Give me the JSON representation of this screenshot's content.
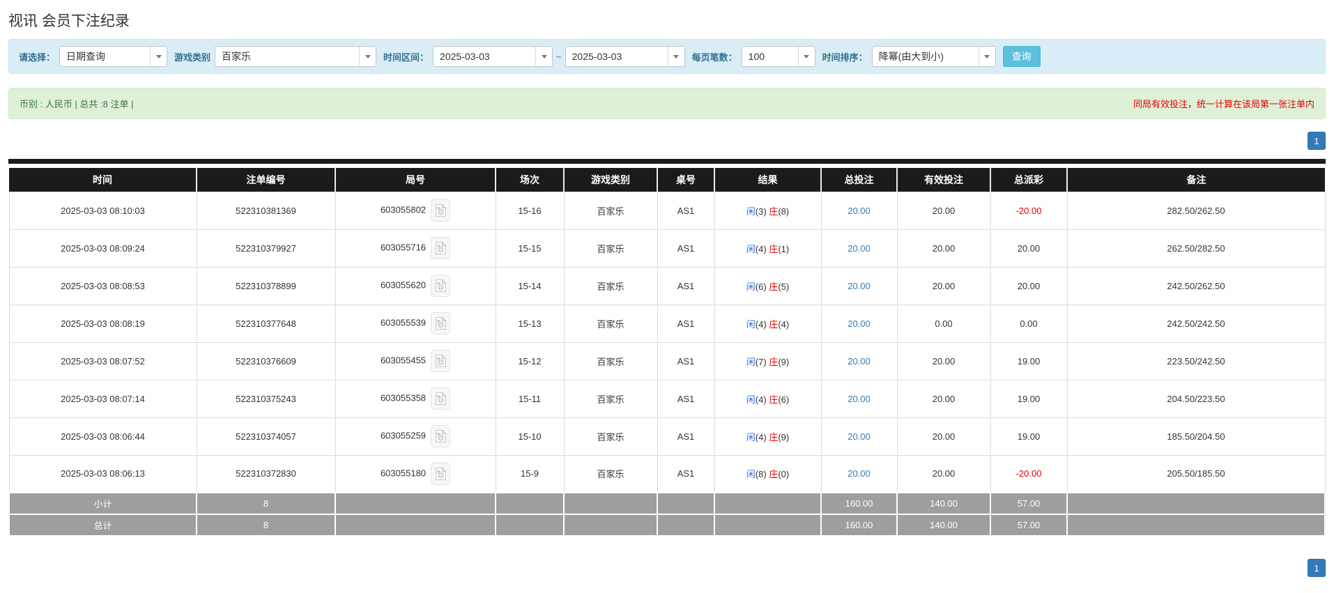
{
  "page": {
    "title": "视讯 会员下注纪录"
  },
  "colors": {
    "accent_blue": "#5bc0de",
    "link_blue": "#337ab7",
    "player_blue": "#2f6bd8",
    "banker_red": "#e60000",
    "negative_red": "#e60000",
    "note_red": "#e00000",
    "filter_bg": "#d9edf7",
    "summary_bg": "#dff0d8",
    "summary_text": "#3c763d",
    "header_bg": "#1b1b1b",
    "footer_bg": "#9e9e9e"
  },
  "icons": {
    "dropdown_arrow": "chevron-down-icon",
    "round_video": "video-record-icon"
  },
  "filter": {
    "select_label": "请选择：",
    "select_value": "日期查询",
    "game_label": "游戏类别",
    "game_value": "百家乐",
    "range_label": "时间区间：",
    "date_from": "2025-03-03",
    "tilde": "~",
    "date_to": "2025-03-03",
    "per_page_label": "每页笔数：",
    "per_page_value": "100",
    "sort_label": "时间排序：",
    "sort_value": "降幂(由大到小)",
    "query_button": "查询"
  },
  "summary": {
    "left": "币别 : 人民币 | 总共 :8 注单 |",
    "right": "同局有效投注，统一计算在该局第一张注单内"
  },
  "pagination": {
    "page": "1"
  },
  "table": {
    "headers": [
      "时间",
      "注单编号",
      "局号",
      "场次",
      "游戏类别",
      "桌号",
      "结果",
      "总投注",
      "有效投注",
      "总派彩",
      "备注"
    ],
    "rows": [
      {
        "time": "2025-03-03 08:10:03",
        "bet_no": "522310381369",
        "round_no": "603055802",
        "session": "15-16",
        "game": "百家乐",
        "table_no": "AS1",
        "result": {
          "player": "闲",
          "player_n": "(3)",
          "banker": "庄",
          "banker_n": "(8)"
        },
        "total_bet": "20.00",
        "valid_bet": "20.00",
        "payout": "-20.00",
        "payout_red": true,
        "remark": "282.50/262.50"
      },
      {
        "time": "2025-03-03 08:09:24",
        "bet_no": "522310379927",
        "round_no": "603055716",
        "session": "15-15",
        "game": "百家乐",
        "table_no": "AS1",
        "result": {
          "player": "闲",
          "player_n": "(4)",
          "banker": "庄",
          "banker_n": "(1)"
        },
        "total_bet": "20.00",
        "valid_bet": "20.00",
        "payout": "20.00",
        "payout_red": false,
        "remark": "262.50/282.50"
      },
      {
        "time": "2025-03-03 08:08:53",
        "bet_no": "522310378899",
        "round_no": "603055620",
        "session": "15-14",
        "game": "百家乐",
        "table_no": "AS1",
        "result": {
          "player": "闲",
          "player_n": "(6)",
          "banker": "庄",
          "banker_n": "(5)"
        },
        "total_bet": "20.00",
        "valid_bet": "20.00",
        "payout": "20.00",
        "payout_red": false,
        "remark": "242.50/262.50"
      },
      {
        "time": "2025-03-03 08:08:19",
        "bet_no": "522310377648",
        "round_no": "603055539",
        "session": "15-13",
        "game": "百家乐",
        "table_no": "AS1",
        "result": {
          "player": "闲",
          "player_n": "(4)",
          "banker": "庄",
          "banker_n": "(4)"
        },
        "total_bet": "20.00",
        "valid_bet": "0.00",
        "payout": "0.00",
        "payout_red": false,
        "remark": "242.50/242.50"
      },
      {
        "time": "2025-03-03 08:07:52",
        "bet_no": "522310376609",
        "round_no": "603055455",
        "session": "15-12",
        "game": "百家乐",
        "table_no": "AS1",
        "result": {
          "player": "闲",
          "player_n": "(7)",
          "banker": "庄",
          "banker_n": "(9)"
        },
        "total_bet": "20.00",
        "valid_bet": "20.00",
        "payout": "19.00",
        "payout_red": false,
        "remark": "223.50/242.50"
      },
      {
        "time": "2025-03-03 08:07:14",
        "bet_no": "522310375243",
        "round_no": "603055358",
        "session": "15-11",
        "game": "百家乐",
        "table_no": "AS1",
        "result": {
          "player": "闲",
          "player_n": "(4)",
          "banker": "庄",
          "banker_n": "(6)"
        },
        "total_bet": "20.00",
        "valid_bet": "20.00",
        "payout": "19.00",
        "payout_red": false,
        "remark": "204.50/223.50"
      },
      {
        "time": "2025-03-03 08:06:44",
        "bet_no": "522310374057",
        "round_no": "603055259",
        "session": "15-10",
        "game": "百家乐",
        "table_no": "AS1",
        "result": {
          "player": "闲",
          "player_n": "(4)",
          "banker": "庄",
          "banker_n": "(9)"
        },
        "total_bet": "20.00",
        "valid_bet": "20.00",
        "payout": "19.00",
        "payout_red": false,
        "remark": "185.50/204.50"
      },
      {
        "time": "2025-03-03 08:06:13",
        "bet_no": "522310372830",
        "round_no": "603055180",
        "session": "15-9",
        "game": "百家乐",
        "table_no": "AS1",
        "result": {
          "player": "闲",
          "player_n": "(8)",
          "banker": "庄",
          "banker_n": "(0)"
        },
        "total_bet": "20.00",
        "valid_bet": "20.00",
        "payout": "-20.00",
        "payout_red": true,
        "remark": "205.50/185.50"
      }
    ],
    "subtotal": {
      "label": "小计",
      "count": "8",
      "total_bet": "160.00",
      "valid_bet": "140.00",
      "payout": "57.00"
    },
    "total": {
      "label": "总计",
      "count": "8",
      "total_bet": "160.00",
      "valid_bet": "140.00",
      "payout": "57.00"
    }
  }
}
